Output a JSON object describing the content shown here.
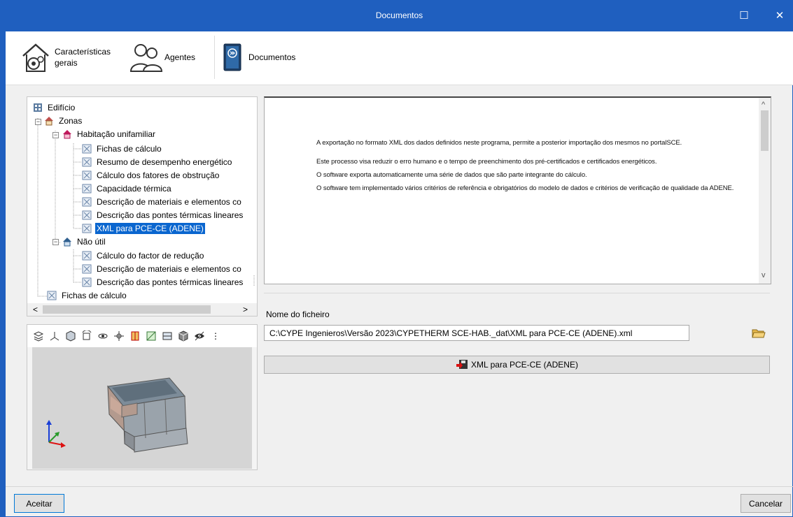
{
  "window": {
    "title": "Documentos",
    "maximize_glyph": "☐",
    "close_glyph": "✕"
  },
  "toolbar": {
    "items": [
      {
        "label_line1": "Características",
        "label_line2": "gerais",
        "icon": "house-gear-icon"
      },
      {
        "label": "Agentes",
        "icon": "people-icon"
      },
      {
        "label": "Documentos",
        "icon": "book-icon"
      }
    ]
  },
  "tree": {
    "nodes": [
      {
        "label": "Edifício",
        "icon": "building-icon"
      },
      {
        "label": "Zonas",
        "icon": "house-icon"
      },
      {
        "label": "Habitação unifamiliar",
        "icon": "house-pink-icon"
      },
      {
        "label": "Fichas de cálculo",
        "icon": "document-icon"
      },
      {
        "label": "Resumo de desempenho energético",
        "icon": "document-icon"
      },
      {
        "label": "Cálculo dos fatores de obstrução",
        "icon": "document-icon"
      },
      {
        "label": "Capacidade térmica",
        "icon": "document-icon"
      },
      {
        "label": "Descrição de materiais e elementos co",
        "icon": "document-icon"
      },
      {
        "label": "Descrição das pontes térmicas lineares",
        "icon": "document-icon"
      },
      {
        "label": "XML para PCE-CE (ADENE)",
        "icon": "document-icon",
        "selected": true
      },
      {
        "label": "Não útil",
        "icon": "house-blue-icon"
      },
      {
        "label": "Cálculo do factor de redução",
        "icon": "document-icon"
      },
      {
        "label": "Descrição de materiais e elementos co",
        "icon": "document-icon"
      },
      {
        "label": "Descrição das pontes térmicas lineares",
        "icon": "document-icon"
      },
      {
        "label": "Fichas de cálculo",
        "icon": "document-icon"
      }
    ],
    "scroll_left": "<",
    "scroll_right": ">"
  },
  "viewer": {
    "tools": [
      "layers-icon",
      "axes-icon",
      "cube-icon",
      "rotate-icon",
      "orbit-icon",
      "pan-icon",
      "section-icon",
      "grid-icon",
      "plan-icon",
      "box-icon",
      "eye-icon"
    ],
    "more": "⋮"
  },
  "description": {
    "paragraphs": [
      "A exportação no formato XML dos dados definidos neste programa, permite a posterior importação dos mesmos no portalSCE.",
      "Este processo visa reduzir o erro humano e o tempo de preenchimento dos pré-certificados e certificados energéticos.",
      "O software exporta automaticamente uma série de dados que são parte integrante do cálculo.",
      "O software tem implementado vários critérios de referência e obrigatórios do modelo de dados e critérios de verificação de qualidade da ADENE."
    ],
    "scroll_up": "^",
    "scroll_down": "v"
  },
  "file": {
    "label": "Nome do ficheiro",
    "value": "C:\\CYPE Ingenieros\\Versão 2023\\CYPETHERM SCE-HAB._dat\\XML para PCE-CE (ADENE).xml"
  },
  "export_button": {
    "label": "XML para PCE-CE (ADENE)"
  },
  "buttons": {
    "accept": "Aceitar",
    "cancel": "Cancelar"
  },
  "colors": {
    "titlebar": "#1f5fbf",
    "selection": "#0a66cf"
  }
}
